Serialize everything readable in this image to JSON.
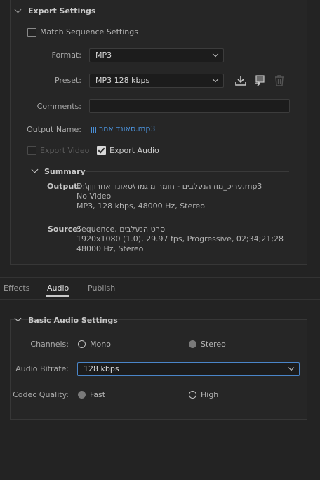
{
  "export_settings": {
    "title": "Export Settings",
    "match_sequence": "Match Sequence Settings",
    "format_label": "Format:",
    "format_value": "MP3",
    "preset_label": "Preset:",
    "preset_value": "MP3 128 kbps",
    "comments_label": "Comments:",
    "comments_value": "",
    "output_name_label": "Output Name:",
    "output_name_value": "סאונד אחרוןןן.mp3",
    "export_video": "Export Video",
    "export_audio": "Export Audio",
    "export_video_checked": false,
    "export_audio_checked": true
  },
  "summary": {
    "title": "Summary",
    "output_label": "Output:",
    "output_lines": [
      "D:\\עריכ_מוז הנעלבים - חומר מוגמר\\סאונד אחרוןןן.mp3",
      "No Video",
      "MP3, 128 kbps, 48000 Hz, Stereo"
    ],
    "source_label": "Source:",
    "source_lines": [
      "Sequence, סרט הנעלבים",
      "1920x1080 (1.0), 29.97 fps, Progressive, 02;34;21;28",
      "48000 Hz, Stereo"
    ]
  },
  "tabs": {
    "effects": "Effects",
    "audio": "Audio",
    "publish": "Publish",
    "active": "audio"
  },
  "basic_audio": {
    "title": "Basic Audio Settings",
    "channels_label": "Channels:",
    "mono": "Mono",
    "stereo": "Stereo",
    "channels_selected": "stereo",
    "bitrate_label": "Audio Bitrate:",
    "bitrate_value": "128 kbps",
    "codec_label": "Codec Quality:",
    "fast": "Fast",
    "high": "High",
    "codec_selected": "fast"
  },
  "colors": {
    "background": "#232323",
    "panel": "#262626",
    "link": "#4a8fd6",
    "focus": "#4a85c8"
  }
}
